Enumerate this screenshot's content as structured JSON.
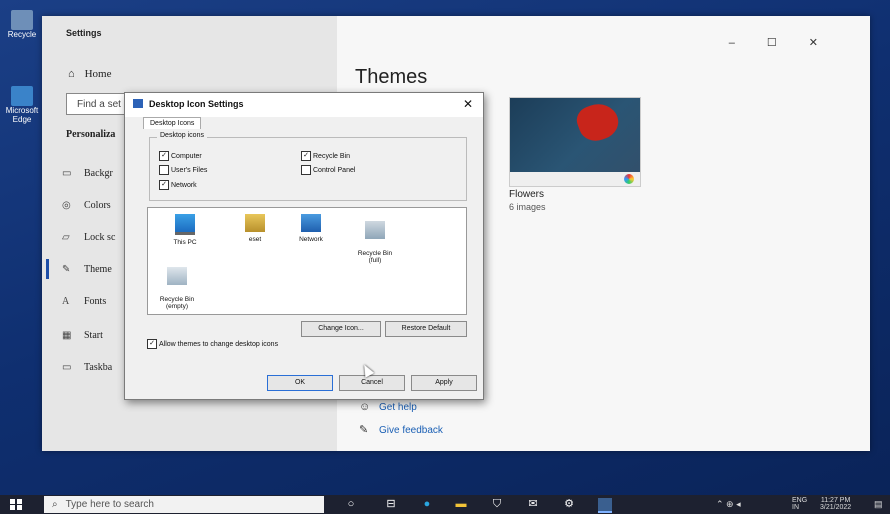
{
  "desktop": {
    "icons": [
      {
        "label": "Recycle"
      },
      {
        "label": "Microsoft Edge"
      }
    ]
  },
  "settings": {
    "title": "Settings",
    "home_label": "Home",
    "search_placeholder": "Find a set",
    "section_label": "Personaliza",
    "nav": [
      {
        "icon": "background-icon",
        "label": "Backgr"
      },
      {
        "icon": "colors-icon",
        "label": "Colors"
      },
      {
        "icon": "lock-screen-icon",
        "label": "Lock sc"
      },
      {
        "icon": "themes-icon",
        "label": "Theme"
      },
      {
        "icon": "fonts-icon",
        "label": "Fonts"
      },
      {
        "icon": "start-icon",
        "label": "Start"
      },
      {
        "icon": "taskbar-icon",
        "label": "Taskba"
      }
    ],
    "active_nav": "Theme",
    "page_title": "Themes",
    "window_controls": [
      "–",
      "☐",
      "✕"
    ],
    "theme_card": {
      "name": "Flowers",
      "count": "6 images"
    },
    "help_links": [
      {
        "icon": "get-help-icon",
        "label": "Get help"
      },
      {
        "icon": "give-feedback-icon",
        "label": "Give feedback"
      }
    ]
  },
  "dialog": {
    "title": "Desktop Icon Settings",
    "close": "✕",
    "tab": "Desktop Icons",
    "group_label": "Desktop icons",
    "checkboxes": [
      {
        "label": "Computer",
        "checked": true
      },
      {
        "label": "Recycle Bin",
        "checked": true
      },
      {
        "label": "User's Files",
        "checked": false
      },
      {
        "label": "Control Panel",
        "checked": false
      },
      {
        "label": "Network",
        "checked": true
      }
    ],
    "icons": [
      {
        "label": "This PC"
      },
      {
        "label": "eset"
      },
      {
        "label": "Network"
      },
      {
        "label": "Recycle Bin\n(full)"
      },
      {
        "label": "Recycle Bin\n(empty)"
      }
    ],
    "change_icon": "Change Icon...",
    "restore_default": "Restore Default",
    "allow_themes": {
      "label": "Allow themes to change desktop icons",
      "checked": true
    },
    "ok": "OK",
    "cancel": "Cancel",
    "apply": "Apply"
  },
  "taskbar": {
    "search_placeholder": "Type here to search",
    "apps": [
      "cortana-icon",
      "task-view-icon",
      "edge-icon",
      "file-explorer-icon",
      "store-icon",
      "mail-icon",
      "settings-icon",
      "app-icon"
    ],
    "tray": {
      "lang": "ENG",
      "region": "IN",
      "time": "11:27 PM",
      "date": "3/21/2022"
    }
  }
}
